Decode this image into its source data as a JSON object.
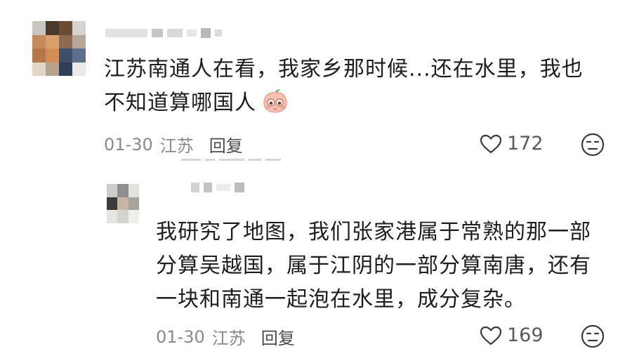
{
  "comment": {
    "text_line1": "江苏南通人在看，我家乡那时候...还在水里，我也",
    "text_line2": "不知道算哪国人",
    "date": "01-30",
    "location": "江苏",
    "reply_label": "回复",
    "likes": "172"
  },
  "reply": {
    "text_line1": "我研究了地图，我们张家港属于常熟的那一部",
    "text_line2": "分算吴越国，属于江阴的一部分算南唐，还有",
    "text_line3": "一块和南通一起泡在水里，成分复杂。",
    "date": "01-30",
    "location": "江苏",
    "reply_label": "回复",
    "likes": "169"
  },
  "icons": {
    "heart": "heart-outline-icon",
    "face": "neutral-face-icon",
    "emoji": "peach-shy-emoji"
  },
  "colors": {
    "text": "#1e1e1e",
    "meta": "#8a8a8a",
    "emoji_pink": "#f6c0b3"
  }
}
